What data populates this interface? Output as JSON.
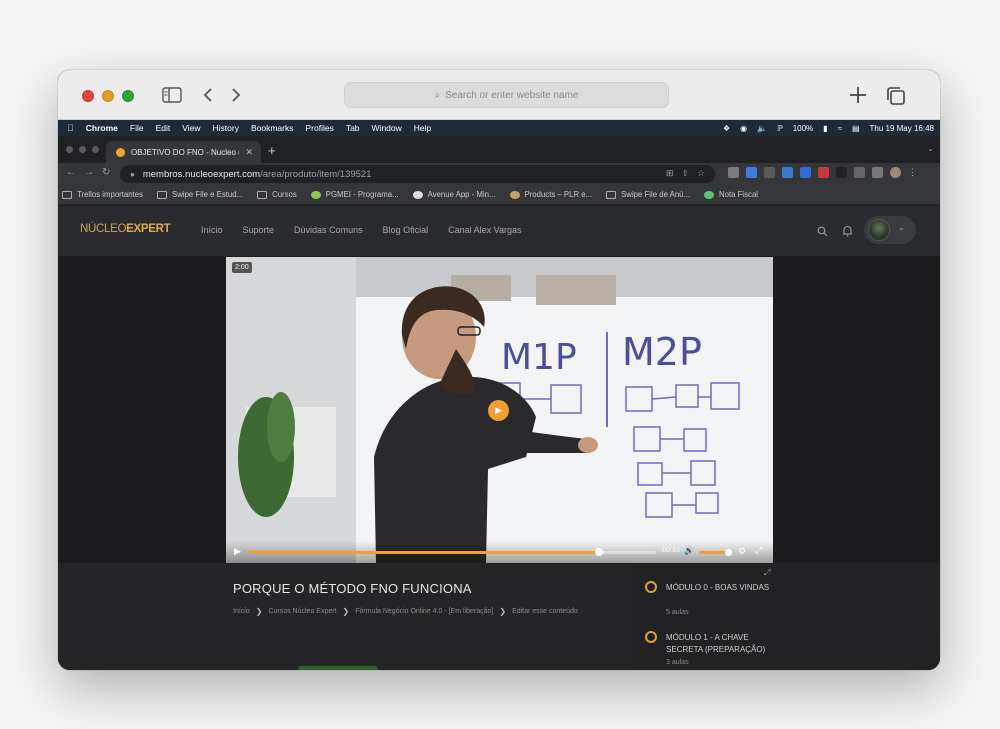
{
  "safari": {
    "search_placeholder": "Search or enter website name",
    "search_icon": "magnifier-icon",
    "sidebar_icon": "sidebar-icon",
    "back_icon": "chevron-left-icon",
    "forward_icon": "chevron-right-icon",
    "new_tab_icon": "plus-icon",
    "tabs_icon": "tab-overview-icon"
  },
  "menubar": {
    "app": "Chrome",
    "items": [
      "File",
      "Edit",
      "View",
      "History",
      "Bookmarks",
      "Profiles",
      "Tab",
      "Window",
      "Help"
    ],
    "battery": "100%",
    "datetime": "Thu 19 May  16:48"
  },
  "chrome": {
    "tab_title": "OBJETIVO DO FNO - Nucleo e",
    "url_host": "membros.nucleoexpert.com",
    "url_path": "/area/produto/item/139521",
    "bookmarks": [
      "Trellos importantes",
      "Swipe File e Estud...",
      "Cursos",
      "PGMEI - Programa...",
      "Avenue App - Min...",
      "Products – PLR e...",
      "Swipe File de Anú...",
      "Nota Fiscal"
    ]
  },
  "site": {
    "logo_part1": "NÚCLEO",
    "logo_part2": "EXPERT",
    "nav": [
      "Início",
      "Suporte",
      "Dúvidas Comuns",
      "Blog Oficial",
      "Canal Alex Vargas"
    ]
  },
  "video": {
    "duration_badge": "2:00",
    "remaining": "-00:33",
    "progress": 0.86,
    "volume": 0.95,
    "whiteboard_left": "M1P",
    "whiteboard_right": "M2P"
  },
  "lesson": {
    "title": "PORQUE O MÉTODO FNO FUNCIONA",
    "breadcrumbs": [
      "Início",
      "Cursos Núcleo Expert",
      "Fórmula Negócio Online 4.0 - [Em liberação]",
      "Editar esse conteúdo"
    ]
  },
  "modules": [
    {
      "title": "MÓDULO 0 - BOAS VINDAS",
      "subtitle": "5 aulas"
    },
    {
      "title": "MÓDULO 1 - A CHAVE SECRETA (PREPARAÇÃO)",
      "subtitle": "3 aulas"
    }
  ],
  "colors": {
    "accent": "#f0a030",
    "logo": "#e3a94e",
    "bg": "#1c1c1e"
  }
}
